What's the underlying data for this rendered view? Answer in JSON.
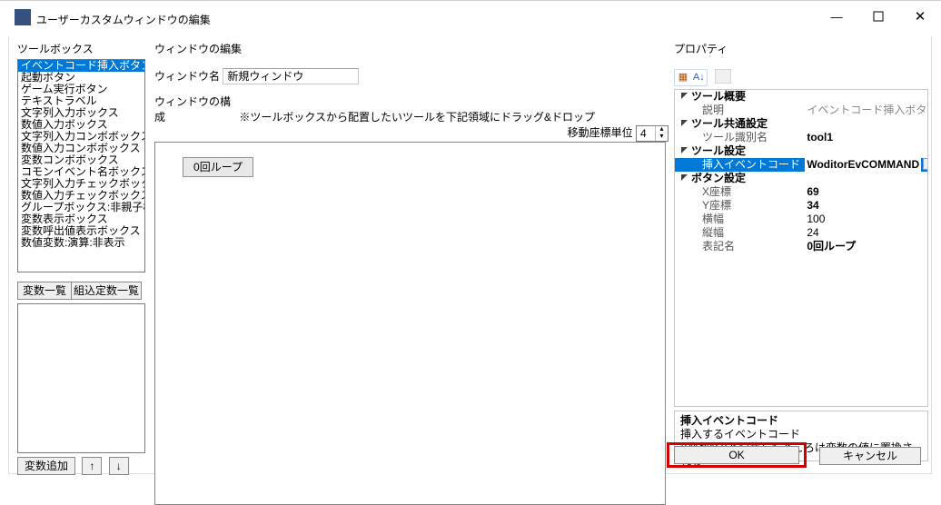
{
  "window": {
    "title": "ユーザーカスタムウィンドウの編集"
  },
  "toolbox": {
    "header": "ツールボックス",
    "items": [
      "イベントコード挿入ボタン",
      "起動ボタン",
      "ゲーム実行ボタン",
      "テキストラベル",
      "文字列入力ボックス",
      "数値入力ボックス",
      "文字列入力コンボボックス",
      "数値入力コンボボックス",
      "変数コンボボックス",
      "コモンイベント名ボックス",
      "文字列入力チェックボックス",
      "数値入力チェックボックス",
      "グループボックス:非親子構造",
      "変数表示ボックス",
      "変数呼出値表示ボックス",
      "数値変数:演算:非表示"
    ],
    "var_buttons": {
      "a": "変数一覧",
      "b": "組込定数一覧"
    },
    "add_button": "変数追加",
    "arrow_up": "↑",
    "arrow_down": "↓"
  },
  "editor": {
    "header": "ウィンドウの編集",
    "name_label": "ウィンドウ名",
    "name_value": "新規ウィンドウ",
    "layout_label": "ウィンドウの構成",
    "hint": "※ツールボックスから配置したいツールを下記領域にドラッグ&ドロップ",
    "unit_label": "移動座標単位",
    "unit_value": "4",
    "loop_button": "0回ループ"
  },
  "properties": {
    "header": "プロパティ",
    "categories": [
      {
        "name": "ツール概要",
        "props": [
          {
            "k": "説明",
            "v": "イベントコード挿入ボタン",
            "muted": true
          }
        ]
      },
      {
        "name": "ツール共通設定",
        "props": [
          {
            "k": "ツール識別名",
            "v": "tool1",
            "bold": true
          }
        ]
      },
      {
        "name": "ツール設定",
        "props": [
          {
            "k": "挿入イベントコード",
            "v": "WoditorEvCOMMAND",
            "bold": true,
            "selected": true
          }
        ]
      },
      {
        "name": "ボタン設定",
        "props": [
          {
            "k": "X座標",
            "v": "69",
            "bold": true
          },
          {
            "k": "Y座標",
            "v": "34",
            "bold": true
          },
          {
            "k": "横幅",
            "v": "100"
          },
          {
            "k": "縦幅",
            "v": "24"
          },
          {
            "k": "表記名",
            "v": "0回ループ",
            "bold": true
          }
        ]
      }
    ],
    "help": {
      "title": "挿入イベントコード",
      "line1": "挿入するイベントコード",
      "line2": "{{変数名}}と記載したところは変数の値に置換される"
    }
  },
  "footer": {
    "ok": "OK",
    "cancel": "キャンセル"
  }
}
